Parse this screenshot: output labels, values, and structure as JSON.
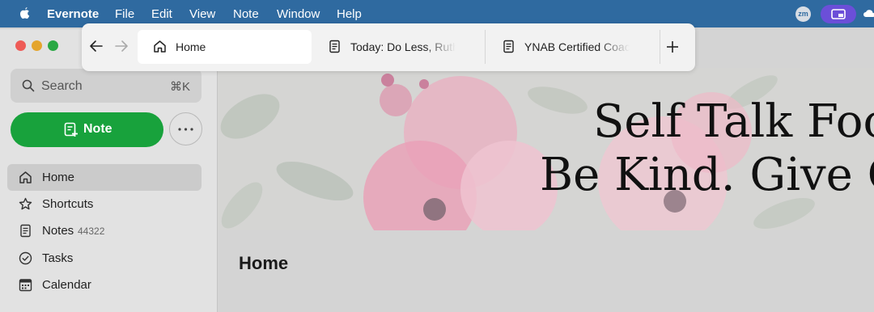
{
  "menubar": {
    "app_name": "Evernote",
    "items": [
      "File",
      "Edit",
      "View",
      "Note",
      "Window",
      "Help"
    ],
    "status_badge": "zm"
  },
  "sidebar": {
    "search": {
      "placeholder": "Search",
      "shortcut": "⌘K"
    },
    "new_note_label": "Note",
    "items": [
      {
        "label": "Home",
        "icon": "home-icon",
        "active": true
      },
      {
        "label": "Shortcuts",
        "icon": "star-icon"
      },
      {
        "label": "Notes",
        "icon": "notes-icon",
        "count": "44322"
      },
      {
        "label": "Tasks",
        "icon": "tasks-icon"
      },
      {
        "label": "Calendar",
        "icon": "calendar-icon"
      }
    ]
  },
  "tabs": [
    {
      "label": "Home",
      "icon": "home-icon",
      "active": true
    },
    {
      "label": "Today: Do Less, Ruthless",
      "icon": "note-icon"
    },
    {
      "label": "YNAB Certified Coach",
      "icon": "note-icon"
    }
  ],
  "banner": {
    "line1": "Self Talk Focus",
    "line2": "Be Kind. Give Grace"
  },
  "main": {
    "title": "Home"
  },
  "colors": {
    "menubar": "#2f6aa0",
    "accent_green": "#18a23c",
    "accent_purple": "#6b4fd8",
    "traffic_red": "#ee5b57",
    "traffic_yellow": "#e4a52d",
    "traffic_green": "#2aa844"
  }
}
